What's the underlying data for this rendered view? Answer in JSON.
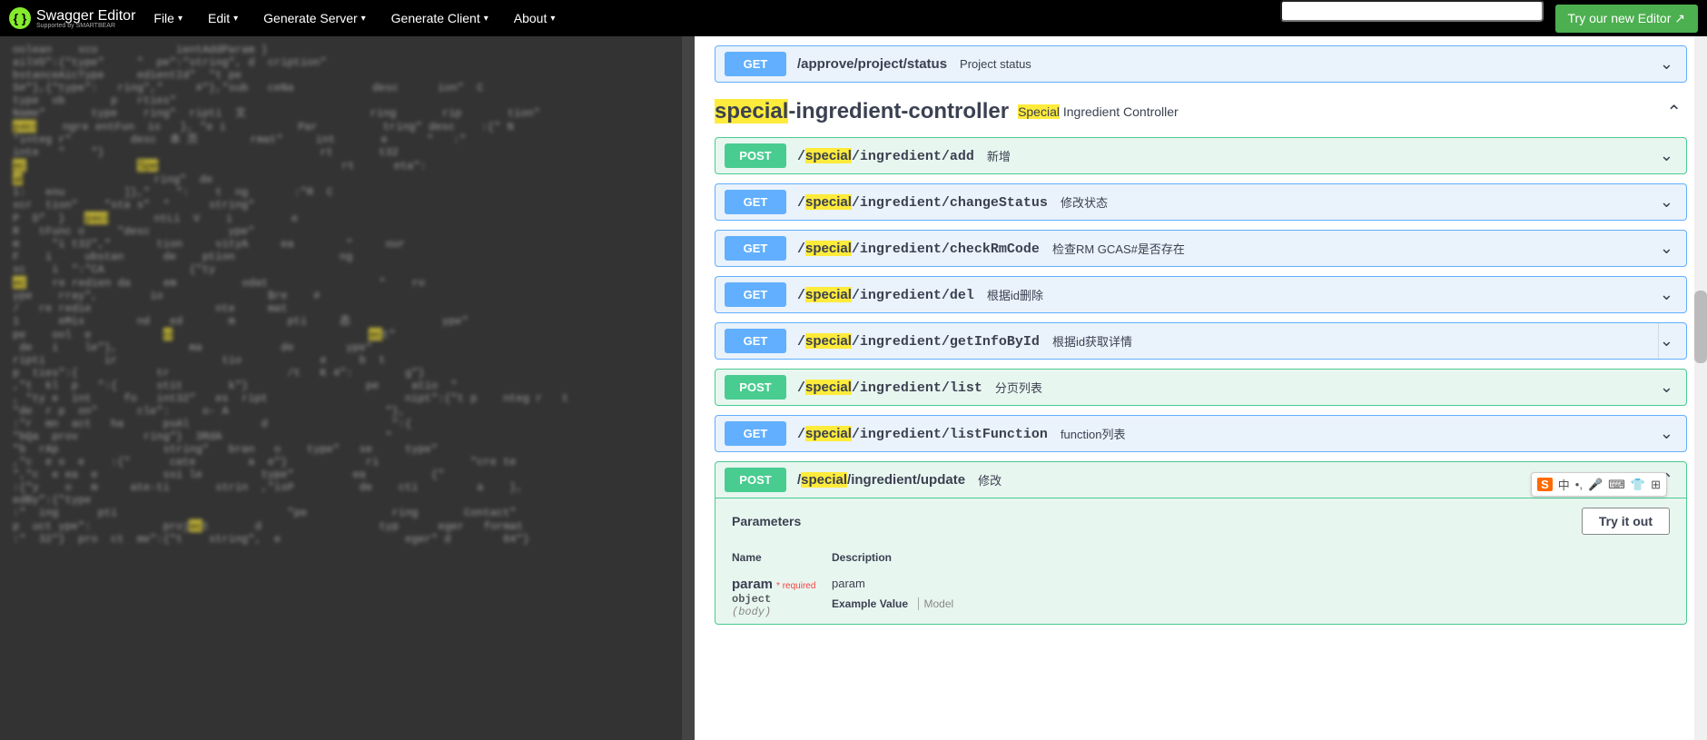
{
  "topbar": {
    "logo_text": "Swagger Editor",
    "logo_sub": "Supported by SMARTBEAR",
    "menu": [
      "File",
      "Edit",
      "Generate Server",
      "Generate Client",
      "About"
    ],
    "try_btn": "Try our new Editor  ↗",
    "search_placeholder": ""
  },
  "endpoints_top": [
    {
      "method": "GET",
      "path_pre": "/approve/project/status",
      "hl": "",
      "path_post": "",
      "summary": "Project status"
    }
  ],
  "tag": {
    "name_hl": "special",
    "name_rest": "-ingredient-controller",
    "desc_hl": "Special",
    "desc_rest": " Ingredient Controller"
  },
  "endpoints": [
    {
      "method": "POST",
      "path_pre": "/",
      "hl": "special",
      "path_post": "/ingredient/add",
      "summary": "新增"
    },
    {
      "method": "GET",
      "path_pre": "/",
      "hl": "special",
      "path_post": "/ingredient/changeStatus",
      "summary": "修改状态"
    },
    {
      "method": "GET",
      "path_pre": "/",
      "hl": "special",
      "path_post": "/ingredient/checkRmCode",
      "summary": "检查RM GCAS#是否存在"
    },
    {
      "method": "GET",
      "path_pre": "/",
      "hl": "special",
      "path_post": "/ingredient/del",
      "summary": "根据id删除"
    },
    {
      "method": "GET",
      "path_pre": "/",
      "hl": "special",
      "path_post": "/ingredient/getInfoById",
      "summary": "根据id获取详情"
    },
    {
      "method": "POST",
      "path_pre": "/",
      "hl": "special",
      "path_post": "/ingredient/list",
      "summary": "分页列表"
    },
    {
      "method": "GET",
      "path_pre": "/",
      "hl": "special",
      "path_post": "/ingredient/listFunction",
      "summary": "function列表"
    }
  ],
  "expanded": {
    "method": "POST",
    "path_pre": "/",
    "hl": "special",
    "path_post": "/ingredient/update",
    "summary": "修改",
    "params_title": "Parameters",
    "try_label": "Try it out",
    "col_name": "Name",
    "col_desc": "Description",
    "param_name": "param",
    "required_text": "* required",
    "param_type": "object",
    "param_in": "(body)",
    "param_desc": "param",
    "example_label": "Example Value",
    "model_label": "Model"
  },
  "ime": {
    "s": "S",
    "items": [
      "中",
      "•,",
      "🎤",
      "⌨",
      "👕",
      "⊞"
    ]
  },
  "editor_fragments": [
    "oolean    sco            ientAddParam }",
    "ailVO\":{\"type\"     \"  pe\":\"string\", d  cription\"",
    "bstanceAicType     edientId\"  \"t pe",
    "S#\"},{\"type\":   ring\",\"     #\"},\"sub   ceNa            desc      ion\"  C",
    "type  ob       p   rties\"",
    "Name\"       type    ring\"  ripti  文                   ring       rip       tion\"",
    "peci    ngre entFun  io   }, \"e i           Par          tring\" desc    :{\" N",
    "\"integ r\"         desc  本 页        rmat\"     int       e      \"   :\"",
    "inte   \"    \"}                                 rt       t32",
    "ec                 Spe                            rt      eta\":",
    "al                    ring\"  de",
    "1:   enu         ]},\"    \":    t  ng       :\"R  C",
    "scr  tion\"    \"sta s\"  \"      string\"",
    "P  D\"  }   peci       ntLi  V    i         e",
    "R   tFunc o     \"desc            ype\"",
    "m     \"i t32\",\"       tion     vityA     ea        \"     our",
    "F    i     ubstan      de    ption                ng",
    "sc    i  \":\"CA             {\"ty",
    "ec    re redien da     em          odat                 \"    ro",
    "ype    rray\",        io                $re    #",
    "/   re redie                   nte     mat",
    "1      eMix        nd   ed       m        pti     态              ype\"",
    "pe    ool  e           ci                              ect\"",
    " de   i    le\"},           ma            de        ype\"",
    "ripti         ir                tio            e     b  t",
    "p  ties\":{            tr                  /t   K 4\":        g\"}",
    ",\"t  kl  p   \":{      stit       k\"}                  pe     atio  \"",
    ", \"ty e  int     fo   int32\"   es  ript                     nipt\":{\"t p    nteg r   t",
    "\"de  r p  on\"      cle\":     o- A                        \"},",
    ":\"r  mn  act   ha      psAl           d                   \":{",
    "\"bQa  prov          ring\"}  3RdA                         \"",
    "\"b  rAp                string\"   bran   o    type\"   se     type\"",
    ",\"c  e o  e    :{\"      cate        a  e\"}            ri              \"cre te",
    "\",\"c  e ea  e          ssi le         type\"         ea          {\"",
    ":{\"y    o   m     ate-ti       strin  ,\"isP          de    cti         a    },",
    "edBy\":{\"type",
    ":\"  ing      pti                          \"pe             ring       Contact\"",
    "p  uct ype\":           project       d                  typ      eger   format",
    ":\"  32\"}  pro  ct  me\":{\"t    string\",  e                   eger\" d        64\"}"
  ]
}
